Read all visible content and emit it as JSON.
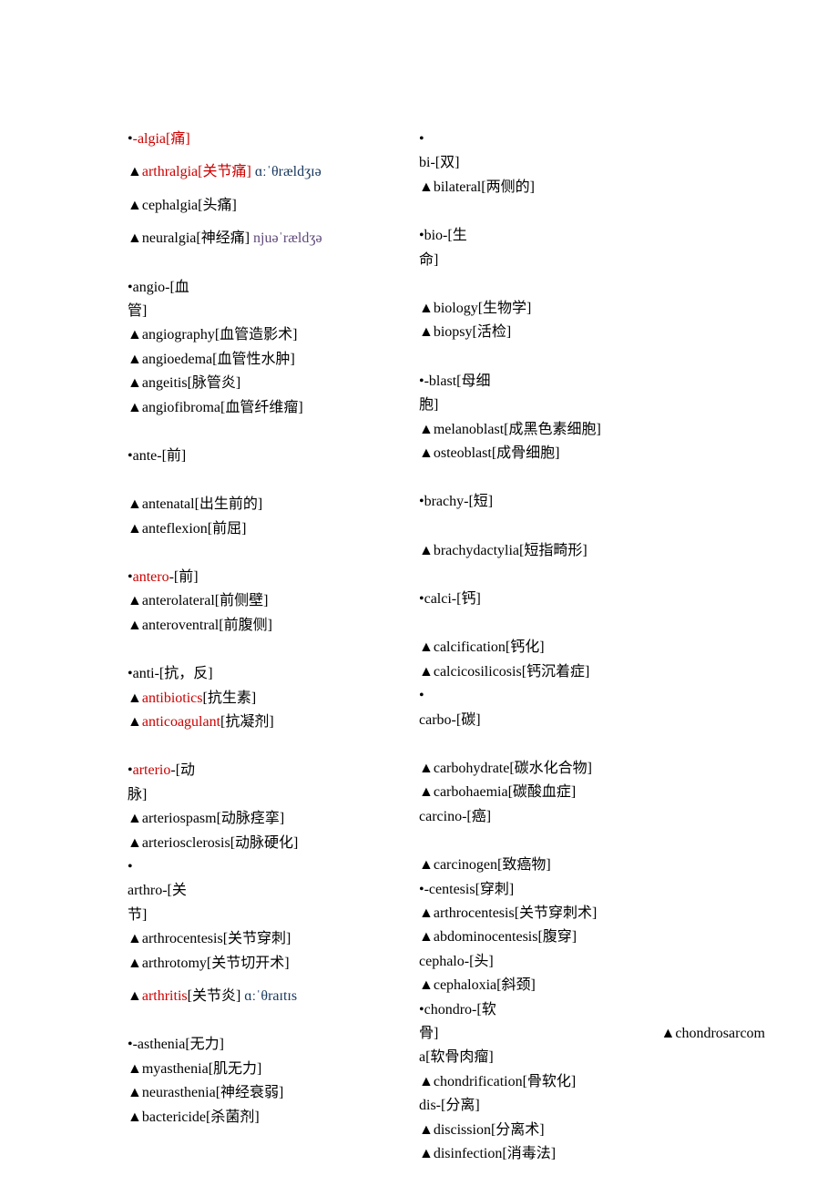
{
  "col1": [
    {
      "t": "mixed",
      "parts": [
        {
          "txt": "•",
          "cls": ""
        },
        {
          "txt": "-algia[痛]",
          "cls": "red"
        }
      ]
    },
    {
      "t": "spacer-small"
    },
    {
      "t": "mixed",
      "parts": [
        {
          "txt": "▲",
          "cls": ""
        },
        {
          "txt": "arthralgia[关节痛] ",
          "cls": "red"
        },
        {
          "txt": "ɑːˈθrældʒɪə",
          "cls": "blue"
        }
      ]
    },
    {
      "t": "spacer-small"
    },
    {
      "t": "line",
      "txt": "▲cephalgia[头痛]"
    },
    {
      "t": "spacer-small"
    },
    {
      "t": "mixed",
      "parts": [
        {
          "txt": "▲neuralgia[神经痛] ",
          "cls": ""
        },
        {
          "txt": "njuəˈrældʒə",
          "cls": "purple"
        }
      ]
    },
    {
      "t": "spacer"
    },
    {
      "t": "line",
      "txt": "•angio-[血"
    },
    {
      "t": "line",
      "txt": "管]"
    },
    {
      "t": "line",
      "txt": "▲angiography[血管造影术]"
    },
    {
      "t": "line",
      "txt": "▲angioedema[血管性水肿]"
    },
    {
      "t": "line",
      "txt": "▲angeitis[脉管炎]"
    },
    {
      "t": "line",
      "txt": "▲angiofibroma[血管纤维瘤]"
    },
    {
      "t": "spacer"
    },
    {
      "t": "line",
      "txt": "•ante-[前]"
    },
    {
      "t": "spacer"
    },
    {
      "t": "line",
      "txt": "▲antenatal[出生前的]"
    },
    {
      "t": "line",
      "txt": "▲anteflexion[前屈]"
    },
    {
      "t": "spacer"
    },
    {
      "t": "mixed",
      "parts": [
        {
          "txt": "•",
          "cls": ""
        },
        {
          "txt": "antero",
          "cls": "red"
        },
        {
          "txt": "-[前]",
          "cls": ""
        }
      ]
    },
    {
      "t": "line",
      "txt": "▲anterolateral[前侧壁]"
    },
    {
      "t": "line",
      "txt": "▲anteroventral[前腹侧]"
    },
    {
      "t": "spacer"
    },
    {
      "t": "line",
      "txt": "•anti-[抗，反]"
    },
    {
      "t": "mixed",
      "parts": [
        {
          "txt": "▲",
          "cls": ""
        },
        {
          "txt": "antibiotics",
          "cls": "red"
        },
        {
          "txt": "[抗生素]",
          "cls": ""
        }
      ]
    },
    {
      "t": "mixed",
      "parts": [
        {
          "txt": "▲",
          "cls": ""
        },
        {
          "txt": "anticoagulant",
          "cls": "red"
        },
        {
          "txt": "[抗凝剂]",
          "cls": ""
        }
      ]
    },
    {
      "t": "spacer"
    },
    {
      "t": "mixed",
      "parts": [
        {
          "txt": "•",
          "cls": ""
        },
        {
          "txt": "arterio",
          "cls": "red"
        },
        {
          "txt": "-[动",
          "cls": ""
        }
      ]
    },
    {
      "t": "line",
      "txt": "脉]"
    },
    {
      "t": "line",
      "txt": "▲arteriospasm[动脉痉挛]"
    },
    {
      "t": "line",
      "txt": "▲arteriosclerosis[动脉硬化]"
    },
    {
      "t": "line",
      "txt": "•"
    },
    {
      "t": "line",
      "txt": "arthro-[关"
    },
    {
      "t": "line",
      "txt": "节]"
    },
    {
      "t": "line",
      "txt": "▲arthrocentesis[关节穿刺]"
    },
    {
      "t": "line",
      "txt": "▲arthrotomy[关节切开术]"
    },
    {
      "t": "spacer-small"
    },
    {
      "t": "mixed",
      "parts": [
        {
          "txt": "▲",
          "cls": ""
        },
        {
          "txt": "arthritis",
          "cls": "red"
        },
        {
          "txt": "[关节炎] ",
          "cls": ""
        },
        {
          "txt": "ɑːˈθraɪtɪs",
          "cls": "blue"
        }
      ]
    },
    {
      "t": "spacer"
    },
    {
      "t": "line",
      "txt": "•-asthenia[无力]"
    },
    {
      "t": "line",
      "txt": "▲myasthenia[肌无力]"
    },
    {
      "t": "line",
      "txt": "▲neurasthenia[神经衰弱]"
    },
    {
      "t": "line",
      "txt": "▲bactericide[杀菌剂]"
    }
  ],
  "col2": [
    {
      "t": "line",
      "txt": "•"
    },
    {
      "t": "line",
      "txt": "bi-[双]"
    },
    {
      "t": "line",
      "txt": "▲bilateral[两侧的]"
    },
    {
      "t": "spacer"
    },
    {
      "t": "line",
      "txt": "•bio-[生"
    },
    {
      "t": "line",
      "txt": "命]"
    },
    {
      "t": "spacer"
    },
    {
      "t": "line",
      "txt": "▲biology[生物学]"
    },
    {
      "t": "line",
      "txt": "▲biopsy[活检]"
    },
    {
      "t": "spacer"
    },
    {
      "t": "line",
      "txt": "•-blast[母细"
    },
    {
      "t": "line",
      "txt": "胞]"
    },
    {
      "t": "line",
      "txt": "▲melanoblast[成黑色素细胞]"
    },
    {
      "t": "line",
      "txt": "▲osteoblast[成骨细胞]"
    },
    {
      "t": "spacer"
    },
    {
      "t": "line",
      "txt": "•brachy-[短]"
    },
    {
      "t": "spacer"
    },
    {
      "t": "line",
      "txt": "▲brachydactylia[短指畸形]"
    },
    {
      "t": "spacer"
    },
    {
      "t": "line",
      "txt": "•calci-[钙]"
    },
    {
      "t": "spacer"
    },
    {
      "t": "line",
      "txt": "▲calcification[钙化]"
    },
    {
      "t": "line",
      "txt": "▲calcicosilicosis[钙沉着症]"
    },
    {
      "t": "line",
      "txt": "•"
    },
    {
      "t": "line",
      "txt": "carbo-[碳]"
    },
    {
      "t": "spacer"
    },
    {
      "t": "line",
      "txt": "▲carbohydrate[碳水化合物]"
    },
    {
      "t": "line",
      "txt": "▲carbohaemia[碳酸血症]"
    },
    {
      "t": "line",
      "txt": "carcino-[癌]"
    },
    {
      "t": "spacer"
    },
    {
      "t": "line",
      "txt": "▲carcinogen[致癌物]"
    },
    {
      "t": "line",
      "txt": "•-centesis[穿刺]"
    },
    {
      "t": "line",
      "txt": "▲arthrocentesis[关节穿刺术]"
    },
    {
      "t": "line",
      "txt": "▲abdominocentesis[腹穿]"
    },
    {
      "t": "line",
      "txt": "cephalo-[头]"
    },
    {
      "t": "line",
      "txt": "▲cephaloxia[斜颈]"
    },
    {
      "t": "line",
      "txt": "•chondro-[软"
    },
    {
      "t": "wrap",
      "left": "骨]",
      "right": "▲chondrosarcom"
    },
    {
      "t": "line",
      "txt": "a[软骨肉瘤]"
    },
    {
      "t": "line",
      "txt": "▲chondrification[骨软化]"
    },
    {
      "t": "line",
      "txt": "dis-[分离]"
    },
    {
      "t": "line",
      "txt": "▲discission[分离术]"
    },
    {
      "t": "line",
      "txt": "▲disinfection[消毒法]"
    }
  ]
}
